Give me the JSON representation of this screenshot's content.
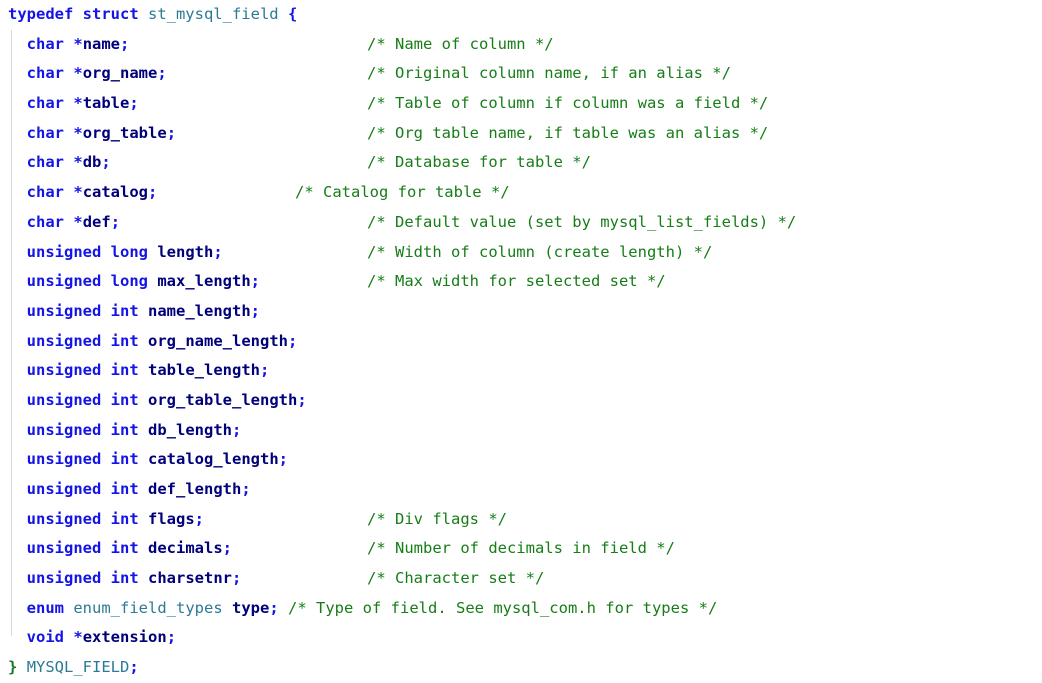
{
  "document": {
    "kind": "source-code-listing",
    "language": "C",
    "struct_name": "st_mysql_field",
    "typedef_name": "MYSQL_FIELD",
    "total_lines": 22,
    "background_color": "#ffffff"
  },
  "colors": {
    "keyword": "#1414e6",
    "type_name": "#2b7a96",
    "identifier": "#00007a",
    "punctuation": "#1414e6",
    "closing_brace": "#157a28",
    "comment": "#167d17",
    "indent_guide": "#d8d8d8"
  },
  "lines": [
    {
      "n": 1,
      "indent": 0,
      "keyword": "typedef struct ",
      "type_name": "st_mysql_field",
      "tail": " {",
      "comment": ""
    },
    {
      "n": 2,
      "indent": 1,
      "keyword": "char ",
      "star": "*",
      "identifier": "name",
      "semi": ";",
      "comment": "/* Name of column */",
      "comment_align": "standard"
    },
    {
      "n": 3,
      "indent": 1,
      "keyword": "char ",
      "star": "*",
      "identifier": "org_name",
      "semi": ";",
      "comment": "/* Original column name, if an alias */",
      "comment_align": "standard"
    },
    {
      "n": 4,
      "indent": 1,
      "keyword": "char ",
      "star": "*",
      "identifier": "table",
      "semi": ";",
      "comment": "/* Table of column if column was a field */",
      "comment_align": "standard"
    },
    {
      "n": 5,
      "indent": 1,
      "keyword": "char ",
      "star": "*",
      "identifier": "org_table",
      "semi": ";",
      "comment": "/* Org table name, if table was an alias */",
      "comment_align": "standard"
    },
    {
      "n": 6,
      "indent": 1,
      "keyword": "char ",
      "star": "*",
      "identifier": "db",
      "semi": ";",
      "comment": "/* Database for table */",
      "comment_align": "standard"
    },
    {
      "n": 7,
      "indent": 1,
      "keyword": "char ",
      "star": "*",
      "identifier": "catalog",
      "semi": ";",
      "comment": "/* Catalog for table */",
      "comment_align": "early"
    },
    {
      "n": 8,
      "indent": 1,
      "keyword": "char ",
      "star": "*",
      "identifier": "def",
      "semi": ";",
      "comment": "/* Default value (set by mysql_list_fields) */",
      "comment_align": "standard"
    },
    {
      "n": 9,
      "indent": 1,
      "keyword": "unsigned long ",
      "star": "",
      "identifier": "length",
      "semi": ";",
      "comment": "/* Width of column (create length) */",
      "comment_align": "standard"
    },
    {
      "n": 10,
      "indent": 1,
      "keyword": "unsigned long ",
      "star": "",
      "identifier": "max_length",
      "semi": ";",
      "comment": "/* Max width for selected set */",
      "comment_align": "standard"
    },
    {
      "n": 11,
      "indent": 1,
      "keyword": "unsigned int ",
      "star": "",
      "identifier": "name_length",
      "semi": ";",
      "comment": ""
    },
    {
      "n": 12,
      "indent": 1,
      "keyword": "unsigned int ",
      "star": "",
      "identifier": "org_name_length",
      "semi": ";",
      "comment": ""
    },
    {
      "n": 13,
      "indent": 1,
      "keyword": "unsigned int ",
      "star": "",
      "identifier": "table_length",
      "semi": ";",
      "comment": ""
    },
    {
      "n": 14,
      "indent": 1,
      "keyword": "unsigned int ",
      "star": "",
      "identifier": "org_table_length",
      "semi": ";",
      "comment": ""
    },
    {
      "n": 15,
      "indent": 1,
      "keyword": "unsigned int ",
      "star": "",
      "identifier": "db_length",
      "semi": ";",
      "comment": ""
    },
    {
      "n": 16,
      "indent": 1,
      "keyword": "unsigned int ",
      "star": "",
      "identifier": "catalog_length",
      "semi": ";",
      "comment": ""
    },
    {
      "n": 17,
      "indent": 1,
      "keyword": "unsigned int ",
      "star": "",
      "identifier": "def_length",
      "semi": ";",
      "comment": ""
    },
    {
      "n": 18,
      "indent": 1,
      "keyword": "unsigned int ",
      "star": "",
      "identifier": "flags",
      "semi": ";",
      "comment": "/* Div flags */",
      "comment_align": "standard"
    },
    {
      "n": 19,
      "indent": 1,
      "keyword": "unsigned int ",
      "star": "",
      "identifier": "decimals",
      "semi": ";",
      "comment": "/* Number of decimals in field */",
      "comment_align": "standard"
    },
    {
      "n": 20,
      "indent": 1,
      "keyword": "unsigned int ",
      "star": "",
      "identifier": "charsetnr",
      "semi": ";",
      "comment": "/* Character set */",
      "comment_align": "standard"
    },
    {
      "n": 21,
      "indent": 1,
      "keyword": "enum ",
      "type_name": "enum_field_types",
      "star": "",
      "identifier": " type",
      "semi": ";",
      "comment": "/* Type of field. See mysql_com.h for types */",
      "comment_align": "inline"
    },
    {
      "n": 22,
      "indent": 1,
      "keyword": "void ",
      "star": "*",
      "identifier": "extension",
      "semi": ";",
      "comment": ""
    },
    {
      "n": 23,
      "indent": 0,
      "closing_brace": "}",
      "type_name": "MYSQL_FIELD",
      "semi": ";",
      "comment": ""
    }
  ]
}
